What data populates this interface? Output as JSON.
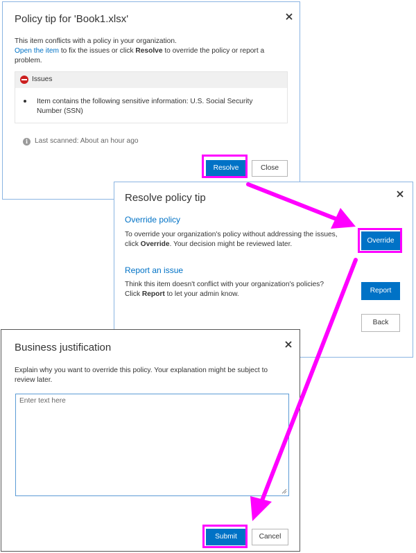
{
  "policy_tip": {
    "title": "Policy tip for 'Book1.xlsx'",
    "message_line1": "This item conflicts with a policy in your organization.",
    "open_item_link": "Open the item",
    "message_mid": " to fix the issues or click ",
    "resolve_word": "Resolve",
    "message_end": " to override the policy or report a problem.",
    "issues_heading": "Issues",
    "issue_text": "Item contains the following sensitive information: U.S. Social Security Number (SSN)",
    "last_scanned": "Last scanned: About an hour ago",
    "resolve_button": "Resolve",
    "close_button": "Close"
  },
  "resolve_tip": {
    "title": "Resolve policy tip",
    "override_heading": "Override policy",
    "override_text_start": "To override your organization's policy without addressing the issues, click ",
    "override_word": "Override",
    "override_text_end": ". Your decision might be reviewed later.",
    "override_button": "Override",
    "report_heading": "Report an issue",
    "report_text_line1": "Think this item doesn't conflict with your organization's policies?",
    "report_text_click": "Click ",
    "report_word": "Report",
    "report_text_end": " to let your admin know.",
    "report_button": "Report",
    "back_button": "Back"
  },
  "justification": {
    "title": "Business justification",
    "instructions": "Explain why you want to override this policy. Your explanation might be subject to review later.",
    "textarea_value": "",
    "textarea_placeholder": "Enter text here",
    "submit_button": "Submit",
    "cancel_button": "Cancel"
  },
  "colors": {
    "primary_blue": "#0072c6",
    "highlight_magenta": "#ff00ff",
    "error_red": "#cc1f1f"
  },
  "icons": [
    "close-icon",
    "stop-icon",
    "info-icon",
    "arrow-icon",
    "resize-grip-icon"
  ]
}
